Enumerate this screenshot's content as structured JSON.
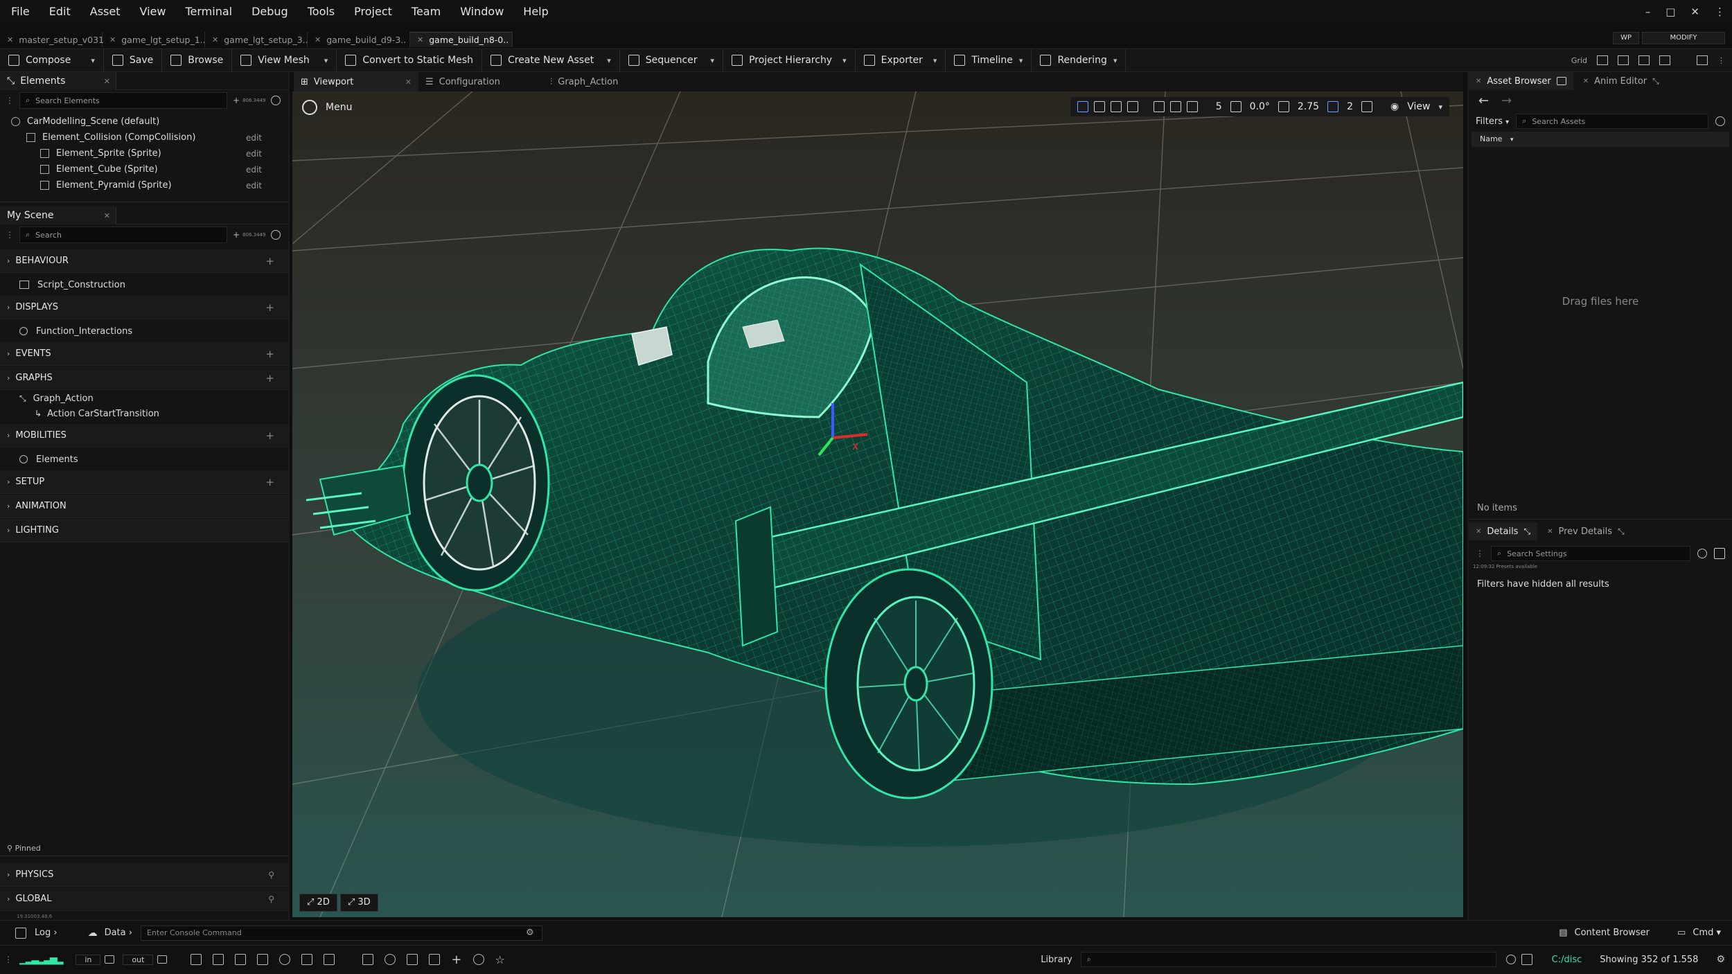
{
  "menu": [
    "File",
    "Edit",
    "Asset",
    "View",
    "Terminal",
    "Debug",
    "Tools",
    "Project",
    "Team",
    "Window",
    "Help"
  ],
  "file_tabs": [
    "master_setup_v031",
    "game_lgt_setup_1..",
    "game_lgt_setup_3..",
    "game_build_d9-3..",
    "game_build_n8-0.."
  ],
  "active_file_tab": 4,
  "mode": {
    "wp": "WP",
    "modify": "MODIFY"
  },
  "toolbar": {
    "compose": "Compose",
    "save": "Save",
    "browse": "Browse",
    "view_mesh": "View Mesh",
    "convert": "Convert to Static Mesh",
    "create_asset": "Create New Asset",
    "sequencer": "Sequencer",
    "project_hierarchy": "Project Hierarchy",
    "exporter": "Exporter",
    "timeline": "Timeline",
    "rendering": "Rendering",
    "grid": "Grid"
  },
  "elements_panel": {
    "tab": "Elements",
    "search_placeholder": "Search Elements",
    "add_label": "+",
    "count": "806.3449",
    "tree": [
      {
        "label": "CarModelling_Scene (default)",
        "edit": ""
      },
      {
        "label": "Element_Collision (CompCollision)",
        "edit": "edit"
      },
      {
        "label": "Element_Sprite (Sprite)",
        "edit": "edit"
      },
      {
        "label": "Element_Cube (Sprite)",
        "edit": "edit"
      },
      {
        "label": "Element_Pyramid (Sprite)",
        "edit": "edit"
      }
    ]
  },
  "scene_panel": {
    "tab": "My Scene",
    "search_placeholder": "Search",
    "count": "806.3449",
    "sections": [
      {
        "name": "BEHAVIOUR",
        "items": [
          "Script_Construction"
        ]
      },
      {
        "name": "DISPLAYS",
        "items": [
          "Function_Interactions"
        ]
      },
      {
        "name": "EVENTS",
        "items": []
      },
      {
        "name": "GRAPHS",
        "items": [
          "Graph_Action",
          "Action CarStartTransition"
        ]
      },
      {
        "name": "MOBILITIES",
        "items": [
          "Elements"
        ]
      },
      {
        "name": "SETUP",
        "items": []
      },
      {
        "name": "ANIMATION",
        "items": []
      },
      {
        "name": "LIGHTING",
        "items": []
      }
    ],
    "pinned": "Pinned",
    "pinned_sections": [
      "PHYSICS",
      "GLOBAL"
    ],
    "version": "19.31003.48.6"
  },
  "viewport": {
    "tabs": [
      "Viewport",
      "Configuration",
      "Graph_Action"
    ],
    "menu": "Menu",
    "grid_snap": "5",
    "angle": "0.0°",
    "scale": "2.75",
    "speed": "2",
    "view": "View",
    "btn_2d": "2D",
    "btn_3d": "3D"
  },
  "asset_browser": {
    "tab": "Asset Browser",
    "tab2": "Anim Editor",
    "filters": "Filters",
    "search_placeholder": "Search Assets",
    "name_col": "Name",
    "drag": "Drag files here",
    "no_items": "No items"
  },
  "details": {
    "tab": "Details",
    "tab2": "Prev Details",
    "search_placeholder": "Search Settings",
    "presets": "12:09:32 Presets available",
    "message": "Filters have hidden all results"
  },
  "bottom": {
    "log": "Log",
    "data": "Data",
    "console_placeholder": "Enter Console Command",
    "content_browser": "Content Browser",
    "cmd": "Cmd",
    "in": "in",
    "out": "out",
    "library": "Library",
    "path": "C:/disc",
    "showing": "Showing 352 of 1.558"
  },
  "colors": {
    "wire": "#2fe7a6",
    "accent": "#6aa0ff"
  }
}
